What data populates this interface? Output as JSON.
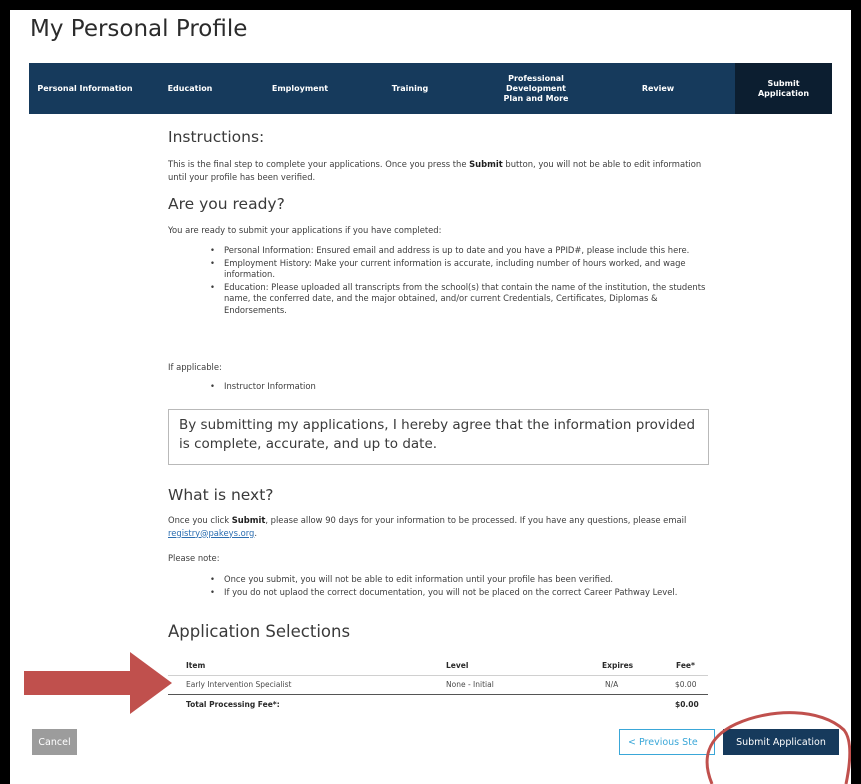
{
  "page": {
    "title": "My Personal Profile"
  },
  "steps": [
    {
      "label": "Personal Information"
    },
    {
      "label": "Education"
    },
    {
      "label": "Employment"
    },
    {
      "label": "Training"
    },
    {
      "label": "Professional Development Plan and More"
    },
    {
      "label": "Review"
    },
    {
      "label": "Submit Application"
    }
  ],
  "instructions": {
    "heading": "Instructions:",
    "text_pre": "This is the final step to complete your applications. Once you press the ",
    "text_bold": "Submit",
    "text_post": " button, you will not be able to edit information until your profile has been verified."
  },
  "ready": {
    "heading": "Are you ready?",
    "intro": "You are ready to submit your applications if you have completed:",
    "items": [
      "Personal Information: Ensured email and address is up to date and you have a PPID#, please include this here.",
      "Employment History: Make your current information is accurate, including number of hours worked, and wage information.",
      "Education: Please uploaded all transcripts from the school(s) that contain the name of the institution, the students name, the conferred date, and the major obtained, and/or current Credentials, Certificates, Diplomas & Endorsements."
    ],
    "if_applicable": "If applicable:",
    "applicable_items": [
      "Instructor Information"
    ]
  },
  "agreement": "By submitting my applications, I hereby agree that the information provided is complete, accurate, and up to date.",
  "next": {
    "heading": "What is next?",
    "text_pre": "Once you click ",
    "text_bold": "Submit",
    "text_mid": ", please allow 90 days for your information to be processed. If you have any questions, please email ",
    "email": "registry@pakeys.org",
    "text_end": ".",
    "note_label": "Please note:",
    "notes": [
      "Once you submit, you will not be able to edit information until your profile has been verified.",
      "If you do not uplaod the correct documentation, you will not be placed on the correct Career Pathway Level."
    ]
  },
  "selections": {
    "heading": "Application Selections",
    "columns": {
      "item": "Item",
      "level": "Level",
      "expires": "Expires",
      "fee": "Fee*"
    },
    "rows": [
      {
        "item": "Early Intervention Specialist",
        "level": "None - Initial",
        "expires": "N/A",
        "fee": "$0.00"
      }
    ],
    "total_label": "Total Processing Fee*:",
    "total_value": "$0.00"
  },
  "buttons": {
    "cancel": "Cancel",
    "previous": "< Previous Ste",
    "submit": "Submit Application"
  },
  "colors": {
    "nav_bg": "#163a5c",
    "nav_active": "#0c1e30",
    "annotation_arrow": "#c0504d",
    "annotation_circle": "#c0504d"
  }
}
